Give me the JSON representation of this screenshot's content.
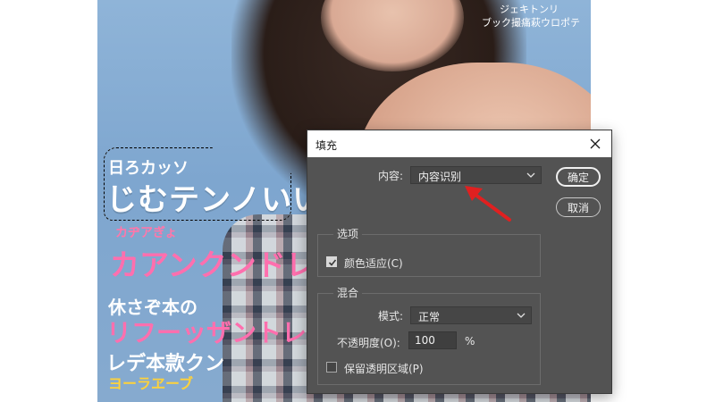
{
  "poster": {
    "line1": "日ろカッソ",
    "line2": "じむテンノいい",
    "line3": "カヂアぎょ",
    "line4": "カアンクンドレ",
    "line5": "休さぞ本の",
    "line6": "リフーッザントレ",
    "line7": "レデ本款クン",
    "line8": "ヨーラヱーブ",
    "corner1": "ジェキトンリ",
    "corner2": "ブック撮痛萩ウロポテ"
  },
  "dialog": {
    "title": "填充",
    "content_label": "内容:",
    "content_value": "内容识别",
    "ok_label": "确定",
    "cancel_label": "取消",
    "options_title": "选项",
    "color_adapt_label": "颜色适应(C)",
    "color_adapt_checked": true,
    "blend_title": "混合",
    "mode_label": "模式:",
    "mode_value": "正常",
    "opacity_label": "不透明度(O):",
    "opacity_value": "100",
    "opacity_unit": "%",
    "preserve_label": "保留透明区域(P)",
    "preserve_checked": false
  },
  "colors": {
    "dialog_bg": "#535353",
    "annotation_arrow": "#e02020"
  },
  "icons": {
    "close": "close-icon",
    "dropdown": "chevron-down-icon",
    "check": "checkmark-icon",
    "annotation": "red-arrow-icon"
  }
}
